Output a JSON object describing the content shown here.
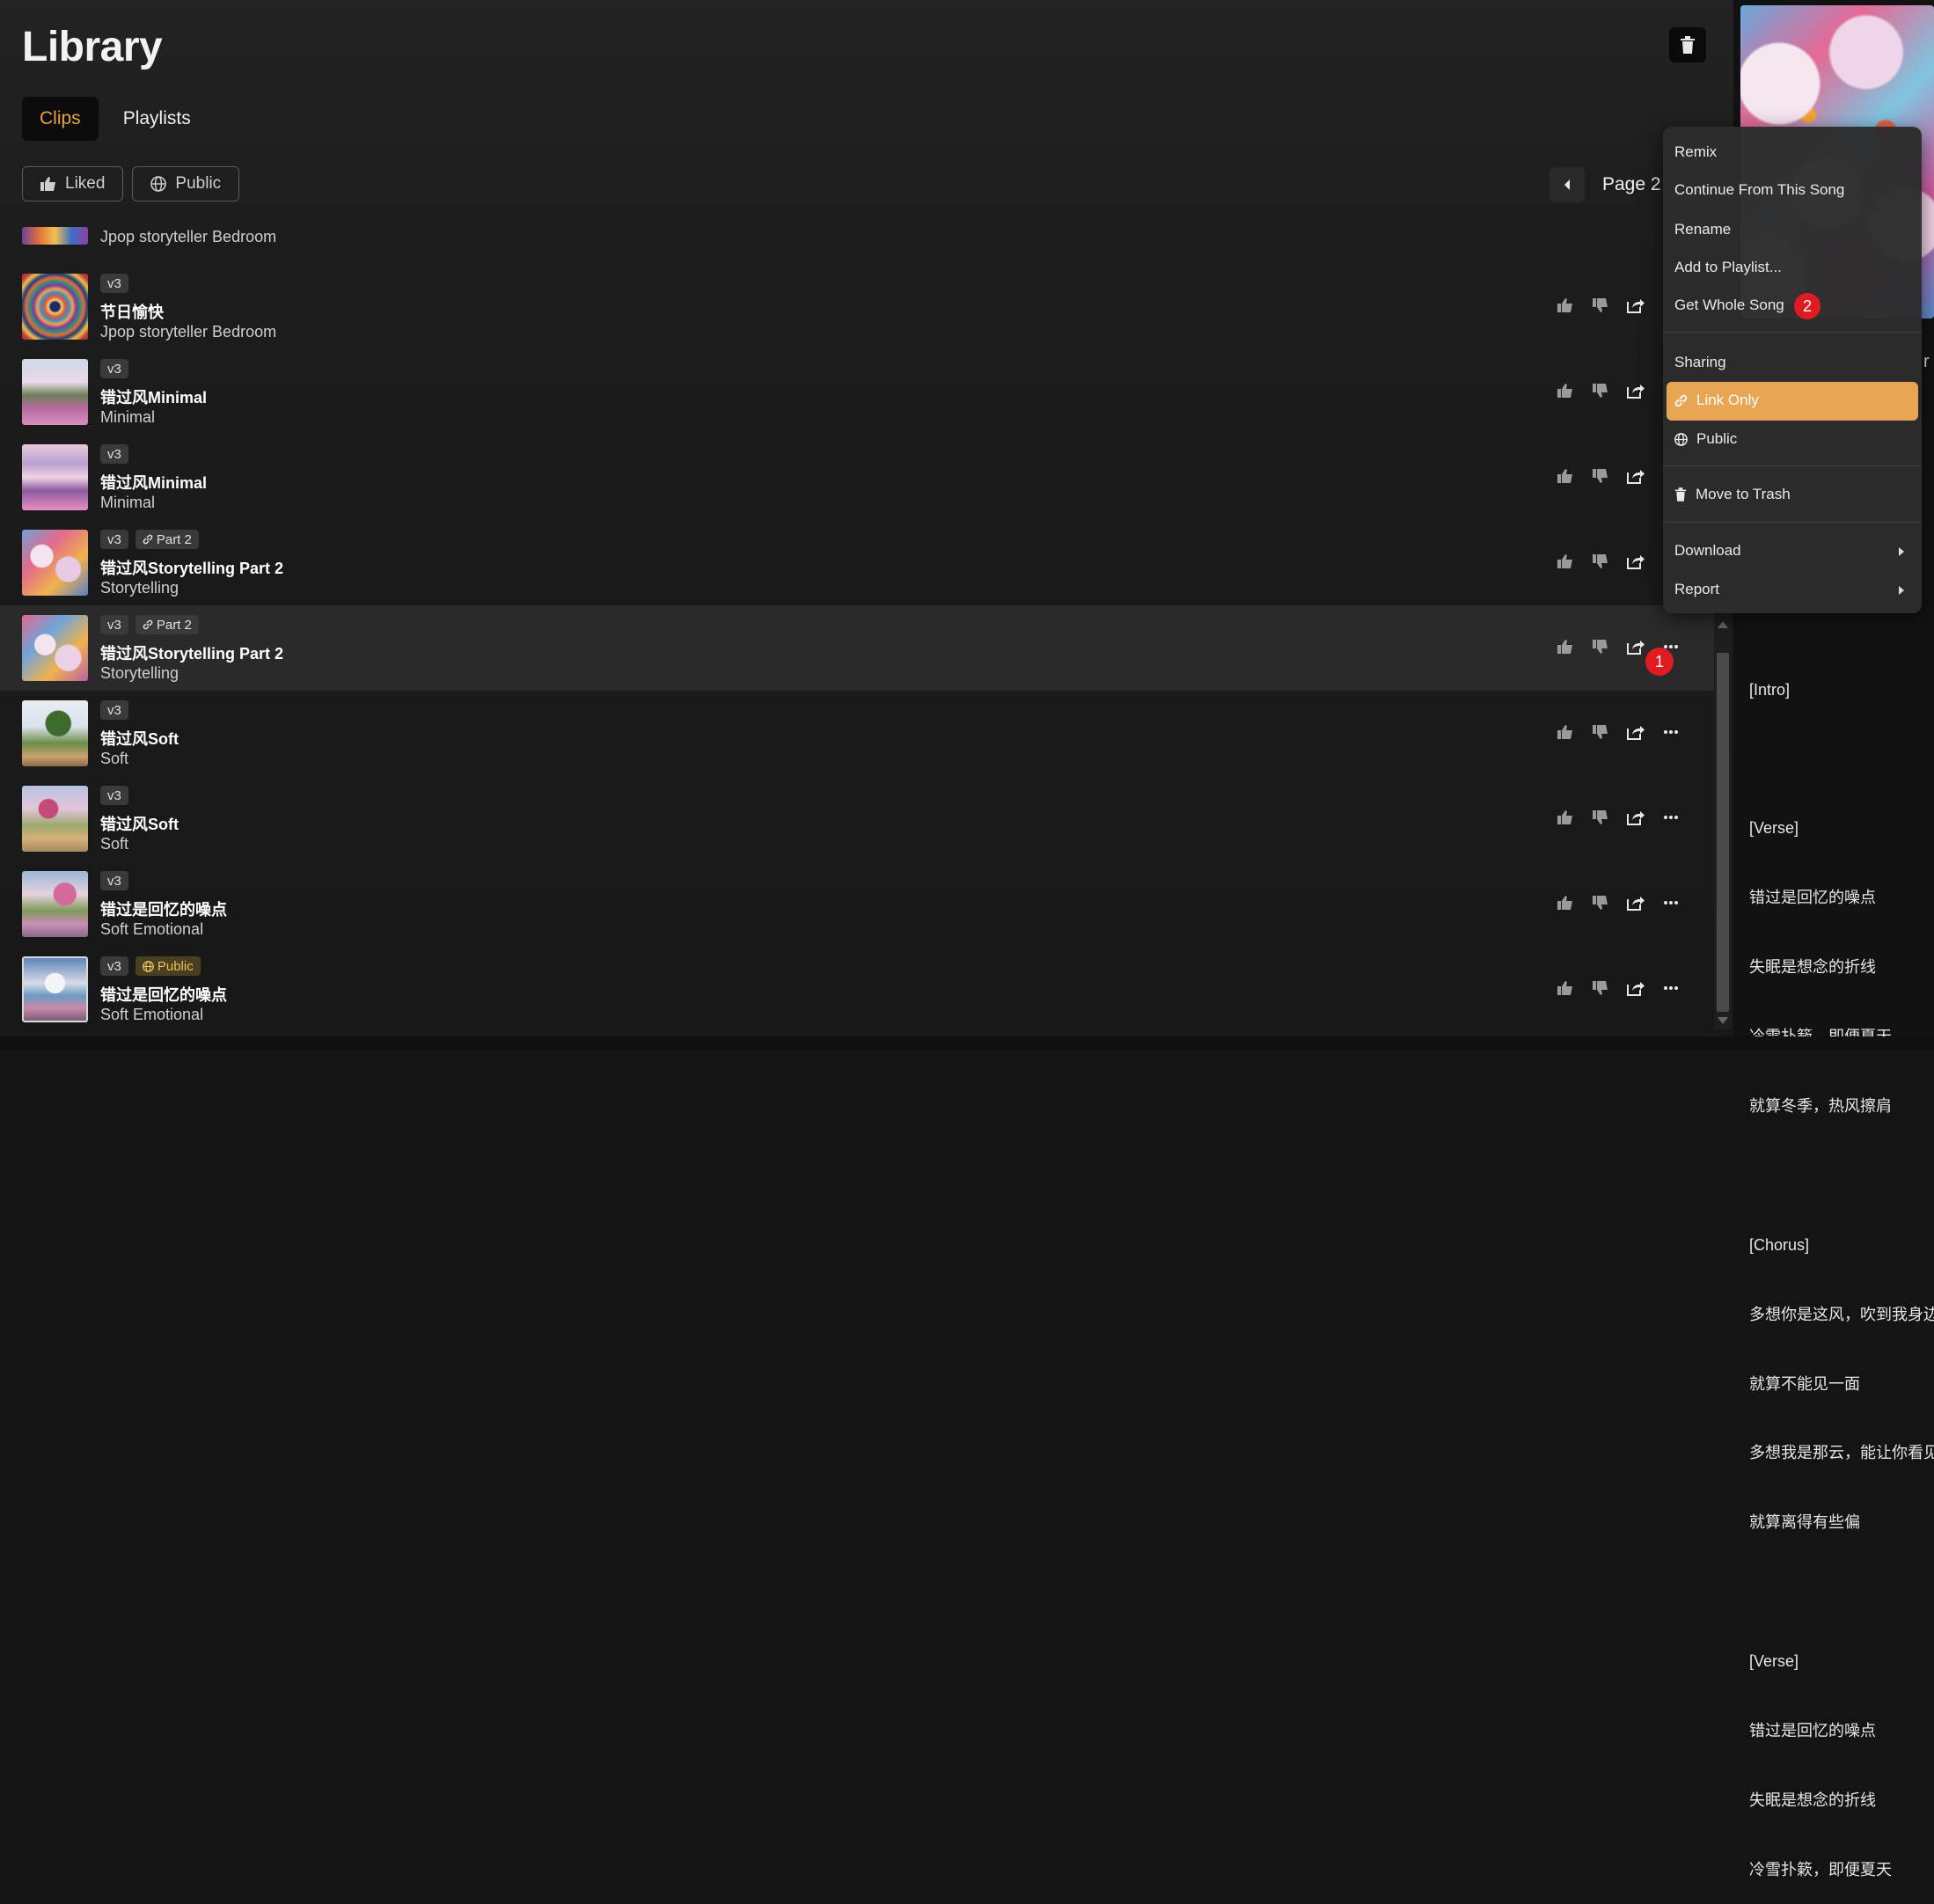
{
  "header": {
    "title": "Library"
  },
  "tabs": [
    {
      "label": "Clips",
      "active": true
    },
    {
      "label": "Playlists",
      "active": false
    }
  ],
  "filters": {
    "liked": "Liked",
    "public": "Public"
  },
  "pager": {
    "label": "Page 2"
  },
  "partial_row": {
    "subtitle": "Jpop storyteller Bedroom"
  },
  "rows": [
    {
      "version": "v3",
      "tag": "",
      "title": "节日愉快",
      "subtitle": "Jpop storyteller Bedroom"
    },
    {
      "version": "v3",
      "tag": "",
      "title": "错过风Minimal",
      "subtitle": "Minimal"
    },
    {
      "version": "v3",
      "tag": "",
      "title": "错过风Minimal",
      "subtitle": "Minimal"
    },
    {
      "version": "v3",
      "tag": "Part 2",
      "title": "错过风Storytelling Part 2",
      "subtitle": "Storytelling"
    },
    {
      "version": "v3",
      "tag": "Part 2",
      "title": "错过风Storytelling Part 2",
      "subtitle": "Storytelling"
    },
    {
      "version": "v3",
      "tag": "",
      "title": "错过风Soft",
      "subtitle": "Soft"
    },
    {
      "version": "v3",
      "tag": "",
      "title": "错过风Soft",
      "subtitle": "Soft"
    },
    {
      "version": "v3",
      "tag": "",
      "title": "错过是回忆的噪点",
      "subtitle": "Soft Emotional"
    },
    {
      "version": "v3",
      "tag": "Public",
      "title": "错过是回忆的噪点",
      "subtitle": "Soft Emotional"
    }
  ],
  "markers": {
    "one": "1",
    "two": "2"
  },
  "menu": {
    "remix": "Remix",
    "continue": "Continue From This Song",
    "rename": "Rename",
    "add_to_playlist": "Add to Playlist...",
    "get_whole_song": "Get Whole Song",
    "sharing": "Sharing",
    "link_only": "Link Only",
    "public": "Public",
    "move_to_trash": "Move to Trash",
    "download": "Download",
    "report": "Report"
  },
  "lyrics": [
    "[Intro]",
    "",
    "[Verse]",
    "错过是回忆的噪点",
    "失眠是想念的折线",
    "冷雪扑簌，即便夏天",
    "就算冬季，热风擦肩",
    "",
    "[Chorus]",
    "多想你是这风，吹到我身边",
    "就算不能见一面",
    "多想我是那云，能让你看见",
    "就算离得有些偏",
    "",
    "[Verse]",
    "错过是回忆的噪点",
    "失眠是想念的折线",
    "冷雪扑簌，即便夏天"
  ],
  "colors": {
    "accent": "#e8a33d",
    "menu_highlight": "#e8a655",
    "marker": "#e01b22"
  }
}
